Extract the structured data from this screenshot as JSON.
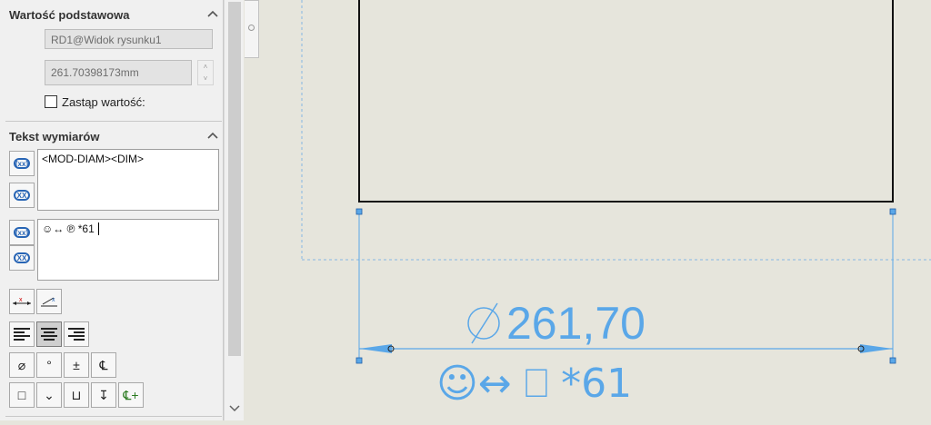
{
  "primary_value": {
    "title": "Wartość podstawowa",
    "name_field": "RD1@Widok rysunku1",
    "value_field": "261.70398173mm",
    "override_label": "Zastąp wartość:"
  },
  "dimension_text": {
    "title": "Tekst wymiarów",
    "main_text": "<MOD-DIAM><DIM>",
    "below_text": "☺↔ ℗ *61"
  },
  "canvas": {
    "diameter_symbol": "∅",
    "dimension_value": "261,70",
    "below_symbols": "☺↔ ⎕ *61",
    "colors": {
      "dimension": "#5aa7e8",
      "sheet_line": "#111111",
      "border_dashed": "#86b8e3"
    }
  },
  "icons": [
    "chevron-up-icon",
    "add-parentheses-icon",
    "center-dimension-icon",
    "offset-text-icon",
    "align-left-icon",
    "align-center-icon",
    "align-right-icon",
    "diameter-icon",
    "degree-icon",
    "plus-minus-icon",
    "centerline-icon",
    "square-icon",
    "countersink-icon",
    "counterbore-icon",
    "depth-icon",
    "more-symbols-icon"
  ],
  "symbol_buttons_row1": [
    "⌀",
    "°",
    "±",
    "℄"
  ],
  "symbol_buttons_row2": [
    "□",
    "⌄",
    "⊔",
    "↧",
    "℄+"
  ]
}
